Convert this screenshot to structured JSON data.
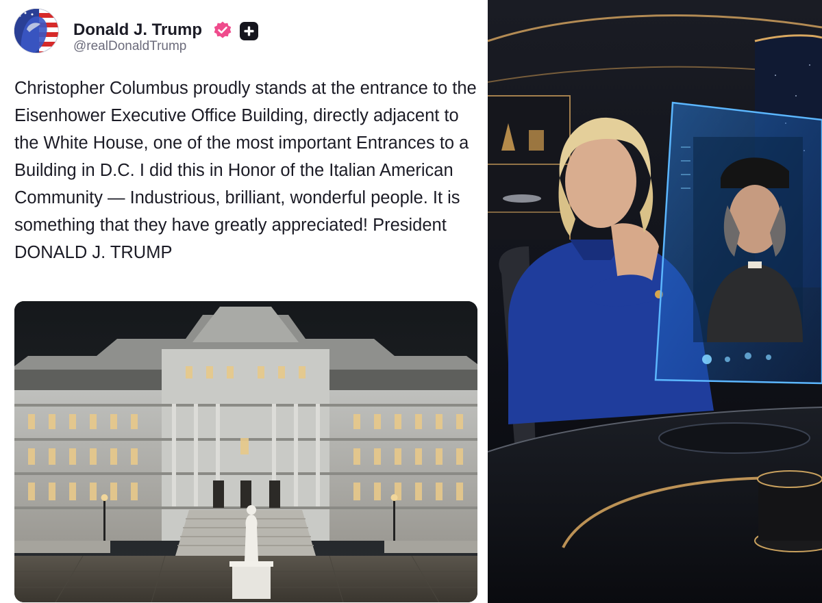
{
  "post": {
    "author": {
      "display_name": "Donald J. Trump",
      "handle": "@realDonaldTrump",
      "verified_icon": "verified-badge-icon",
      "action_icon": "plus-icon"
    },
    "text": "Christopher Columbus proudly stands at the entrance to the Eisenhower Executive Office Building, directly adjacent to the White House, one of the most important Entrances to a Building in D.C. I did this in Honor of the Italian American Community — Industrious, brilliant, wonderful people. It is something that they have greatly appreciated! President DONALD J. TRUMP",
    "attached_image": "eisenhower-building-photo"
  },
  "side_image": "scifi-columbus-artwork",
  "colors": {
    "text": "#1b1b25",
    "handle": "#6b6b7b",
    "verified": "#ef4b8c",
    "holo": "#4aa8ff"
  }
}
